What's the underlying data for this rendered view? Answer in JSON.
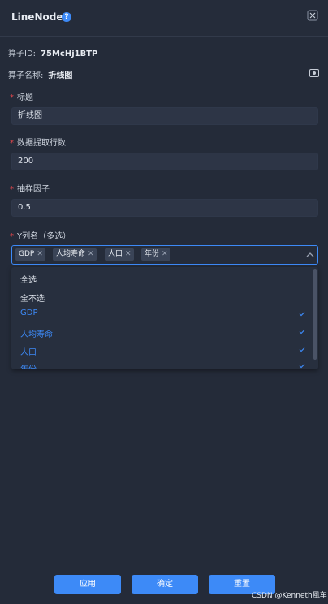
{
  "header": {
    "title": "LineNode",
    "help_icon": "?"
  },
  "info": {
    "id_label": "算子ID:",
    "id_value": "75McHj1BTP",
    "name_label": "算子名称:",
    "name_value": "折线图"
  },
  "fields": {
    "title": {
      "label": "标题",
      "value": "折线图"
    },
    "rows": {
      "label": "数据提取行数",
      "value": "200"
    },
    "sample": {
      "label": "抽样因子",
      "value": "0.5"
    },
    "ycols": {
      "label": "Y列名（多选）"
    }
  },
  "tags": [
    "GDP",
    "人均寿命",
    "人口",
    "年份"
  ],
  "dropdown": {
    "options": [
      "全选",
      "全不选",
      "GDP",
      "人均寿命",
      "人口",
      "年份"
    ]
  },
  "buttons": {
    "apply": "应用",
    "confirm": "确定",
    "reset": "重置"
  },
  "watermark": "CSDN @Kenneth風车",
  "colors": {
    "accent": "#3d8af7",
    "required": "#e5484d",
    "background": "#242b39"
  }
}
